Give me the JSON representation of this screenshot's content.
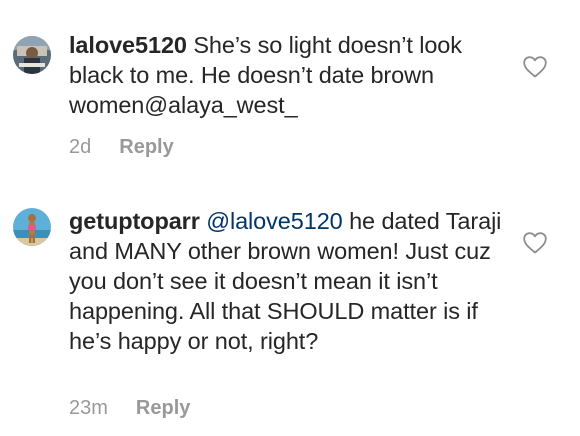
{
  "comments": [
    {
      "username": "lalove5120",
      "text": " She’s so light doesn’t look black to me. He doesn’t date brown women@alaya_west_",
      "mention": "",
      "time": "2d",
      "reply_label": "Reply",
      "avatar_icon": "profile-avatar-icon",
      "like_icon": "heart-outline-icon"
    },
    {
      "username": "getuptoparr",
      "mention": "@lalove5120",
      "text": " he dated Taraji and MANY other brown women! Just cuz you don’t see it doesn’t mean it isn’t happening. All that SHOULD matter is if he’s happy or not, right?",
      "time": "23m",
      "reply_label": "Reply",
      "avatar_icon": "profile-avatar-icon",
      "like_icon": "heart-outline-icon"
    }
  ],
  "colors": {
    "text": "#262626",
    "meta": "#999999",
    "mention": "#003569"
  }
}
